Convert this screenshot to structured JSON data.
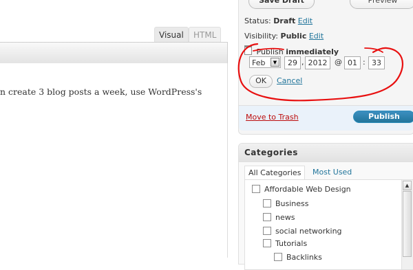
{
  "editor": {
    "tabs": {
      "visual": "Visual",
      "html": "HTML"
    },
    "body_text": "n create 3 blog posts a week, use WordPress's"
  },
  "publish": {
    "save_draft_label": "Save Draft",
    "preview_label": "Preview",
    "status_label": "Status:",
    "status_value": "Draft",
    "visibility_label": "Visibility:",
    "visibility_value": "Public",
    "edit_link": "Edit",
    "publish_label": "Publish",
    "publish_value": "immediately",
    "month": "Feb",
    "day": "29",
    "year": "2012",
    "hour": "01",
    "minute": "33",
    "comma": ",",
    "at": "@",
    "colon": ":",
    "ok_label": "OK",
    "cancel_label": "Cancel",
    "trash_label": "Move to Trash",
    "publish_button": "Publish"
  },
  "categories": {
    "title": "Categories",
    "tab_all": "All Categories",
    "tab_most_used": "Most Used",
    "items": [
      {
        "label": "Affordable Web Design",
        "level": 0
      },
      {
        "label": "Business",
        "level": 1
      },
      {
        "label": "news",
        "level": 1
      },
      {
        "label": "social networking",
        "level": 1
      },
      {
        "label": "Tutorials",
        "level": 1
      },
      {
        "label": "Backlinks",
        "level": 2
      }
    ]
  },
  "colors": {
    "link": "#21759b",
    "trash": "#bc0b0b",
    "publish_button": "#21759b",
    "annotation": "#e81010"
  },
  "icons": [
    "calendar-icon",
    "dropdown-arrow-icon",
    "scroll-up-icon",
    "checkbox-icon"
  ]
}
